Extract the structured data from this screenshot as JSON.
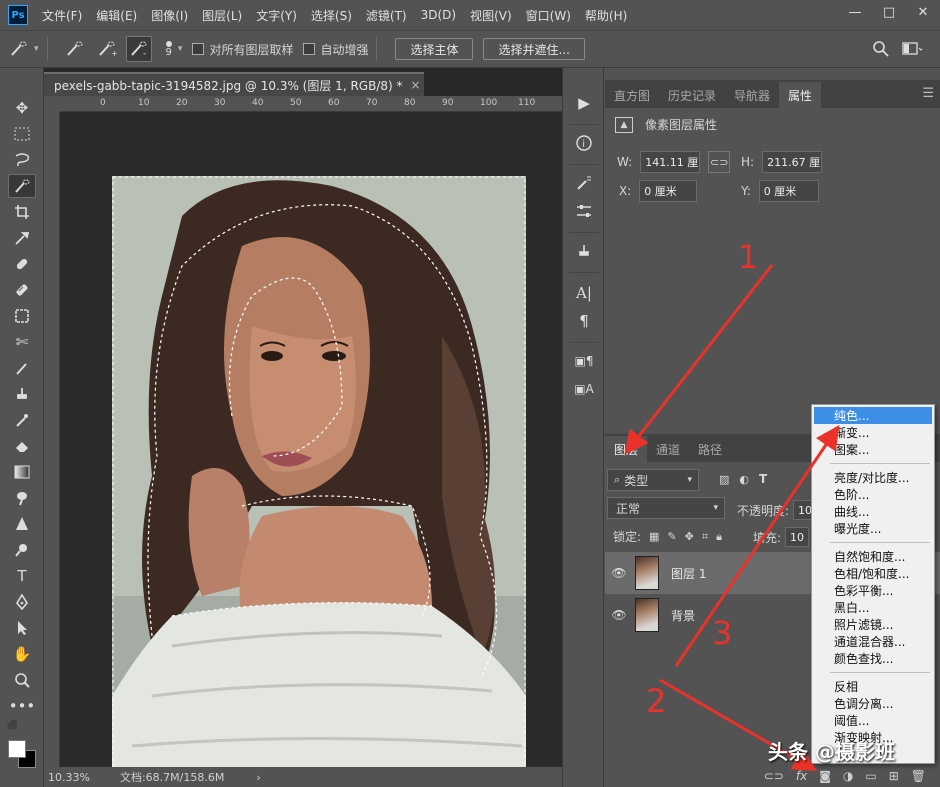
{
  "app": {
    "logo": "Ps",
    "menu": [
      "文件(F)",
      "编辑(E)",
      "图像(I)",
      "图层(L)",
      "文字(Y)",
      "选择(S)",
      "滤镜(T)",
      "3D(D)",
      "视图(V)",
      "窗口(W)",
      "帮助(H)"
    ],
    "window_controls": [
      "—",
      "□",
      "✕"
    ]
  },
  "options": {
    "brush_size": "9",
    "sample_all": "对所有图层取样",
    "auto_enhance": "自动增强",
    "select_subject": "选择主体",
    "select_and_mask": "选择并遮住..."
  },
  "document": {
    "tab_title": "pexels-gabb-tapic-3194582.jpg @ 10.3% (图层 1, RGB/8) *",
    "tab_close": "×",
    "ruler_ticks": [
      "0",
      "10",
      "20",
      "30",
      "40",
      "50",
      "60",
      "70",
      "80",
      "90",
      "100",
      "110"
    ],
    "zoom": "10.33%",
    "doc_size": "文档:68.7M/158.6M",
    "status_arrow": "›"
  },
  "properties_panel": {
    "tabs": [
      "直方图",
      "历史记录",
      "导航器",
      "属性"
    ],
    "active_tab": "属性",
    "heading": "像素图层属性",
    "w_label": "W:",
    "w_value": "141.11 厘",
    "h_label": "H:",
    "h_value": "211.67 厘",
    "x_label": "X:",
    "x_value": "0 厘米",
    "y_label": "Y:",
    "y_value": "0 厘米"
  },
  "layers_panel": {
    "tabs": [
      "图层",
      "通道",
      "路径"
    ],
    "active_tab": "图层",
    "filter_kind": "类型",
    "blend_mode": "正常",
    "opacity_label": "不透明度:",
    "opacity_value": "10",
    "lock_label": "锁定:",
    "fill_label": "填充:",
    "fill_value": "10",
    "layers": [
      {
        "name": "图层 1",
        "selected": true
      },
      {
        "name": "背景",
        "selected": false
      }
    ],
    "bottom_icons": [
      "link-icon",
      "fx-icon",
      "mask-icon",
      "adjustment-icon",
      "folder-icon",
      "new-layer-icon",
      "trash-icon"
    ],
    "fx_label": "fx"
  },
  "adjustment_menu": {
    "group1": [
      "纯色...",
      "渐变...",
      "图案..."
    ],
    "group2": [
      "亮度/对比度...",
      "色阶...",
      "曲线...",
      "曝光度..."
    ],
    "group3": [
      "自然饱和度...",
      "色相/饱和度...",
      "色彩平衡...",
      "黑白...",
      "照片滤镜...",
      "通道混合器...",
      "颜色查找..."
    ],
    "group4": [
      "反相",
      "色调分离...",
      "阈值...",
      "渐变映射..."
    ],
    "highlighted": "纯色..."
  },
  "annotations": {
    "numbers": [
      "1",
      "2",
      "3"
    ],
    "arrow_color": "#e8322a"
  },
  "watermark": "头条 @摄影班"
}
